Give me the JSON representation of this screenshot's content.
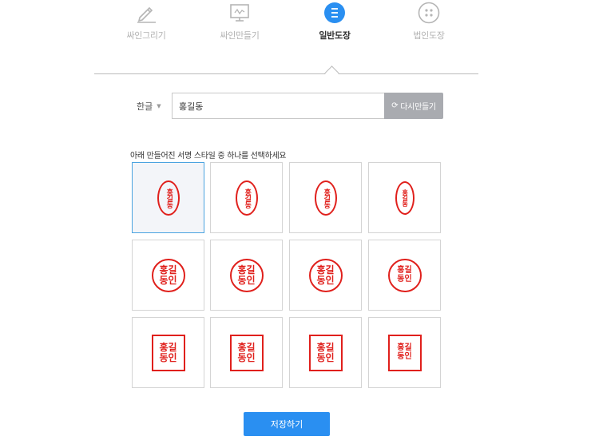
{
  "tabs": [
    {
      "label": "싸인그리기",
      "icon": "pen-icon"
    },
    {
      "label": "싸인만들기",
      "icon": "signature-board-icon"
    },
    {
      "label": "일반도장",
      "icon": "menu-lines-icon"
    },
    {
      "label": "법인도장",
      "icon": "grid-seal-icon"
    }
  ],
  "active_tab": "일반도장",
  "colors": {
    "accent": "#2a8ff1",
    "stamp_red": "#e0201c",
    "regen_gray": "#a9abb0",
    "selected_border": "#4aa3e0"
  },
  "lang_select": {
    "value": "한글"
  },
  "name_input": {
    "value": "홍길동"
  },
  "regen_button": {
    "label": "다시만들기",
    "icon": "refresh-icon"
  },
  "instruction": "아래 만들어진 서명 스타일 중 하나를 선택하세요",
  "stamps": [
    {
      "style": "oval",
      "text": "홍길동"
    },
    {
      "style": "oval",
      "text": "홍길동"
    },
    {
      "style": "oval",
      "text": "홍길동"
    },
    {
      "style": "oval",
      "text": "홍길동"
    },
    {
      "style": "circle",
      "text": "홍길\n동인"
    },
    {
      "style": "circle",
      "text": "홍길\n동인"
    },
    {
      "style": "circle",
      "text": "홍길\n동인"
    },
    {
      "style": "circle",
      "text": "홍길\n동인"
    },
    {
      "style": "square",
      "text": "홍길\n동인"
    },
    {
      "style": "square",
      "text": "홍길\n동인"
    },
    {
      "style": "square",
      "text": "홍길\n동인"
    },
    {
      "style": "square",
      "text": "홍길\n동인"
    }
  ],
  "selected_stamp": 1,
  "save_button": {
    "label": "저장하기"
  }
}
